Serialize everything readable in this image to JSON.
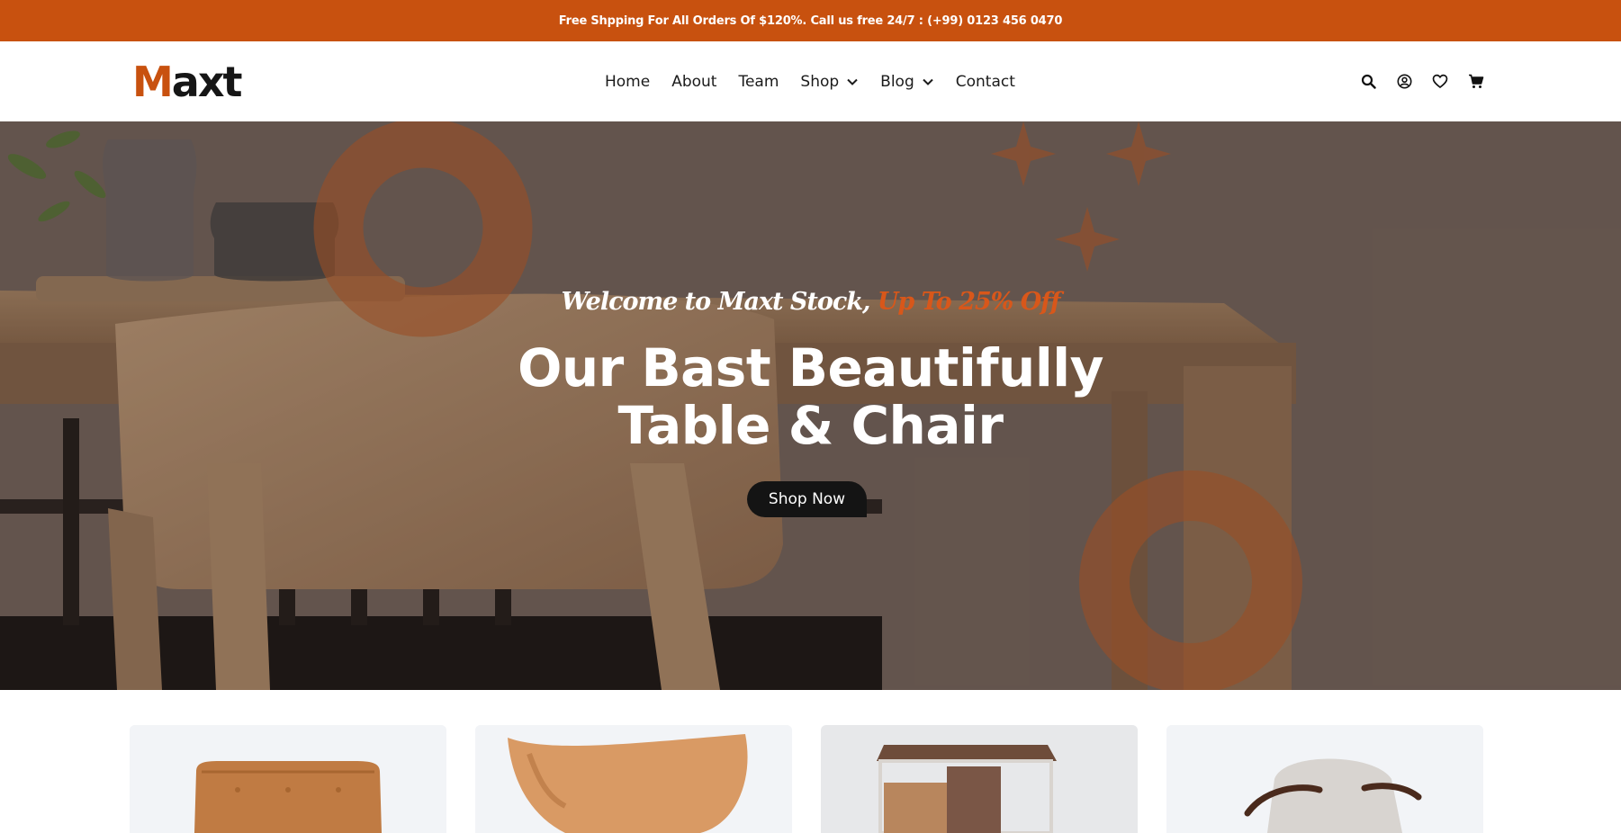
{
  "topbar": {
    "text": "Free Shpping For All Orders Of $120%. Call us free 24/7 : (+99) 0123 456 0470"
  },
  "header": {
    "logo_first": "M",
    "logo_rest": "axt",
    "nav": [
      {
        "label": "Home"
      },
      {
        "label": "About"
      },
      {
        "label": "Team"
      },
      {
        "label": "Shop"
      },
      {
        "label": "Blog"
      },
      {
        "label": "Contact"
      }
    ],
    "icons": [
      "search-icon",
      "user-icon",
      "heart-icon",
      "cart-icon"
    ]
  },
  "hero": {
    "tag_white": "Welcome to Maxt Stock,",
    "tag_orange": "Up To 25% Off",
    "title_line1": "Our Bast Beautifully",
    "title_line2": "Table & Chair",
    "button": "Shop Now"
  },
  "products": [
    {
      "image": "leather-ottoman"
    },
    {
      "image": "wooden-bowl-chair"
    },
    {
      "image": "side-table-cabinet"
    },
    {
      "image": "armchair"
    }
  ],
  "colors": {
    "accent": "#c8510f",
    "dark": "#141414",
    "background": "#ffffff"
  }
}
